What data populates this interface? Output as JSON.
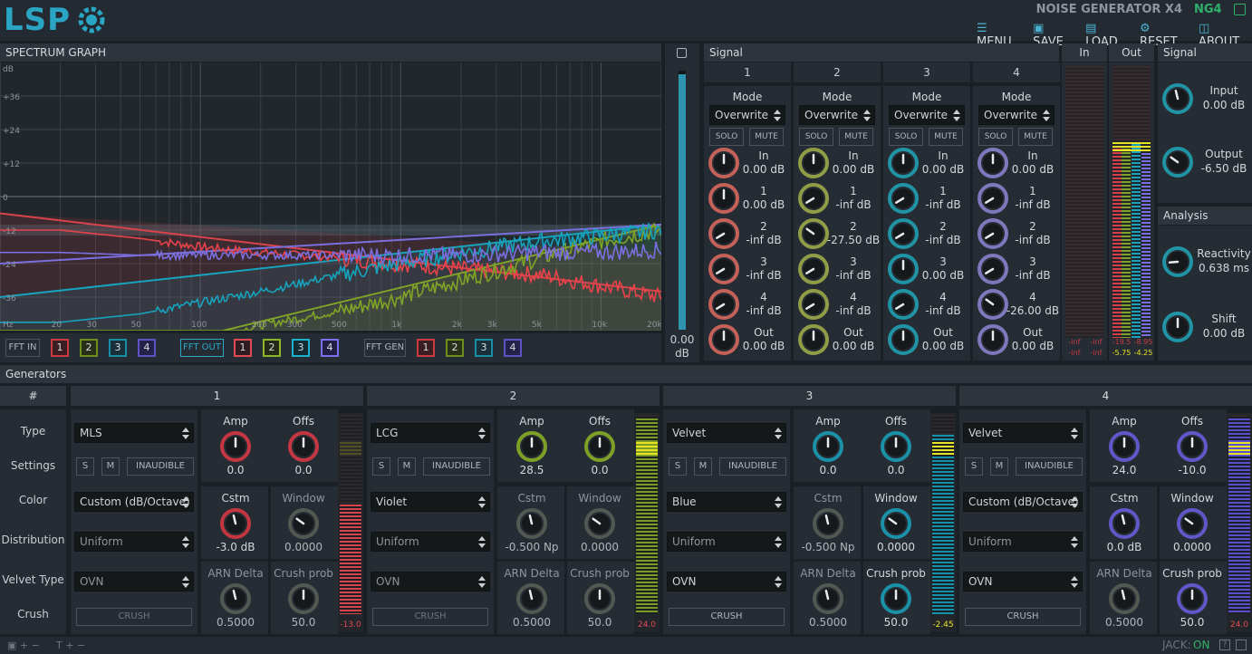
{
  "app": {
    "title": "NOISE GENERATOR X4",
    "code": "NG4",
    "logo": "LSP"
  },
  "menu": [
    {
      "icon": "menu-icon",
      "label": "MENU"
    },
    {
      "icon": "save-icon",
      "label": "SAVE"
    },
    {
      "icon": "load-icon",
      "label": "LOAD"
    },
    {
      "icon": "reset-icon",
      "label": "RESET"
    },
    {
      "icon": "about-icon",
      "label": "ABOUT"
    }
  ],
  "spectrum": {
    "title": "SPECTRUM GRAPH",
    "ylabels": [
      "dB",
      "+36",
      "+24",
      "+12",
      "0",
      "-12",
      "-24",
      "-36"
    ],
    "xlabels": [
      "Hz",
      "20",
      "30",
      "50",
      "100",
      "200",
      "300",
      "500",
      "1k",
      "2k",
      "3k",
      "5k",
      "10k",
      "20k"
    ],
    "buttons": {
      "fft_in": "FFT IN",
      "fft_out": "FFT OUT",
      "fft_gen": "FFT GEN",
      "nums": [
        "1",
        "2",
        "3",
        "4"
      ]
    }
  },
  "chart_data": {
    "type": "line",
    "xlabel": "Hz",
    "ylabel": "dB",
    "ylim": [
      -48,
      48
    ],
    "xscale": "log",
    "xlim": [
      10,
      20000
    ],
    "x": [
      20,
      50,
      100,
      200,
      500,
      1000,
      2000,
      5000,
      10000,
      20000
    ],
    "series": [
      {
        "color": "#e8434b",
        "values": [
          -12,
          -15,
          -18,
          -20,
          -22,
          -24,
          -26,
          -28,
          -32,
          -36
        ]
      },
      {
        "color": "#7fa327",
        "values": [
          -60,
          -58,
          -52,
          -46,
          -41,
          -36,
          -30,
          -22,
          -16,
          -12
        ]
      },
      {
        "color": "#17a3bd",
        "values": [
          -45,
          -42,
          -38,
          -34,
          -28,
          -24,
          -20,
          -16,
          -14,
          -12
        ]
      },
      {
        "color": "#7b6fe0",
        "values": [
          -20,
          -21,
          -21,
          -21,
          -21,
          -21,
          -21,
          -20,
          -20,
          -19
        ]
      }
    ]
  },
  "gain": {
    "value": "0.00",
    "unit": "dB"
  },
  "signal": {
    "title": "Signal",
    "channels": [
      {
        "num": "1",
        "mode": "Overwrite",
        "solo": "SOLO",
        "mute": "MUTE",
        "color": "#e06b60",
        "knobs": [
          [
            "In",
            "0.00 dB"
          ],
          [
            "1",
            "0.00 dB"
          ],
          [
            "2",
            "-inf dB"
          ],
          [
            "3",
            "-inf dB"
          ],
          [
            "4",
            "-inf dB"
          ],
          [
            "Out",
            "0.00 dB"
          ]
        ]
      },
      {
        "num": "2",
        "mode": "Overwrite",
        "solo": "SOLO",
        "mute": "MUTE",
        "color": "#a5b24a",
        "knobs": [
          [
            "In",
            "0.00 dB"
          ],
          [
            "1",
            "-inf dB"
          ],
          [
            "2",
            "-27.50 dB"
          ],
          [
            "3",
            "-inf dB"
          ],
          [
            "4",
            "-inf dB"
          ],
          [
            "Out",
            "0.00 dB"
          ]
        ]
      },
      {
        "num": "3",
        "mode": "Overwrite",
        "solo": "SOLO",
        "mute": "MUTE",
        "color": "#20a6b8",
        "knobs": [
          [
            "In",
            "0.00 dB"
          ],
          [
            "1",
            "-inf dB"
          ],
          [
            "2",
            "-inf dB"
          ],
          [
            "3",
            "0.00 dB"
          ],
          [
            "4",
            "-inf dB"
          ],
          [
            "Out",
            "0.00 dB"
          ]
        ]
      },
      {
        "num": "4",
        "mode": "Overwrite",
        "solo": "SOLO",
        "mute": "MUTE",
        "color": "#8f86d6",
        "knobs": [
          [
            "In",
            "0.00 dB"
          ],
          [
            "1",
            "-inf dB"
          ],
          [
            "2",
            "-inf dB"
          ],
          [
            "3",
            "-inf dB"
          ],
          [
            "4",
            "-26.00 dB"
          ],
          [
            "Out",
            "0.00 dB"
          ]
        ]
      }
    ]
  },
  "meters": {
    "in": "In",
    "out": "Out",
    "in_vals": [
      "-inf",
      "-inf",
      "-inf",
      "-inf"
    ],
    "out_vals": [
      "-19.5",
      "-8.95",
      "-5.75",
      "-4.25"
    ]
  },
  "side": {
    "signal_title": "Signal",
    "input_label": "Input",
    "input_val": "0.00 dB",
    "output_label": "Output",
    "output_val": "-6.50 dB",
    "analysis_title": "Analysis",
    "react_label": "Reactivity",
    "react_val": "0.638 ms",
    "shift_label": "Shift",
    "shift_val": "0.00 dB"
  },
  "generators": {
    "title": "Generators",
    "hash": "#",
    "rows": [
      "Type",
      "Settings",
      "Color",
      "Distribution",
      "Velvet Type",
      "Crush"
    ],
    "gens": [
      {
        "num": "1",
        "type": "MLS",
        "s": "S",
        "m": "M",
        "inaudible": "INAUDIBLE",
        "color": "Custom (dB/Octave)",
        "dist": "Uniform",
        "vtype": "OVN",
        "crush": "CRUSH",
        "kcol": "#e03a45",
        "amp": "0.0",
        "offs": "0.0",
        "cstm": "-3.0 dB",
        "window": "0.0000",
        "arn": "0.5000",
        "cprob": "50.0",
        "meter": "-13.0",
        "mcol": "#d9434b",
        "level": 0.55,
        "amp_l": "Amp",
        "offs_l": "Offs",
        "cstm_l": "Cstm",
        "window_l": "Window",
        "arn_l": "ARN Delta",
        "cprob_l": "Crush prob"
      },
      {
        "num": "2",
        "type": "LCG",
        "s": "S",
        "m": "M",
        "inaudible": "INAUDIBLE",
        "color": "Violet",
        "dist": "Uniform",
        "vtype": "OVN",
        "crush": "CRUSH",
        "kcol": "#8eb526",
        "amp": "28.5",
        "offs": "0.0",
        "cstm": "-0.500 Np",
        "window": "0.0000",
        "arn": "0.5000",
        "cprob": "50.0",
        "meter": "24.0",
        "mcol": "#7c9d23",
        "level": 0.98,
        "amp_l": "Amp",
        "offs_l": "Offs",
        "cstm_l": "Cstm",
        "window_l": "Window",
        "arn_l": "ARN Delta",
        "cprob_l": "Crush prob"
      },
      {
        "num": "3",
        "type": "Velvet",
        "s": "S",
        "m": "M",
        "inaudible": "INAUDIBLE",
        "color": "Blue",
        "dist": "Uniform",
        "vtype": "OVN",
        "crush": "CRUSH",
        "kcol": "#1aa3bc",
        "amp": "0.0",
        "offs": "0.0",
        "cstm": "-0.500 Np",
        "window": "0.0000",
        "arn": "0.5000",
        "cprob": "50.0",
        "meter": "-2.45",
        "mcol": "#1592ab",
        "level": 0.9,
        "amp_l": "Amp",
        "offs_l": "Offs",
        "cstm_l": "Cstm",
        "window_l": "Window",
        "arn_l": "ARN Delta",
        "cprob_l": "Crush prob"
      },
      {
        "num": "4",
        "type": "Velvet",
        "s": "S",
        "m": "M",
        "inaudible": "INAUDIBLE",
        "color": "Custom (dB/Octave)",
        "dist": "Uniform",
        "vtype": "OVN",
        "crush": "CRUSH",
        "kcol": "#6b5fe3",
        "amp": "24.0",
        "offs": "-10.0",
        "cstm": "0.0 dB",
        "window": "0.0000",
        "arn": "0.5000",
        "cprob": "50.0",
        "meter": "24.0",
        "mcol": "#5b4fcf",
        "level": 0.98,
        "amp_l": "Amp",
        "offs_l": "Offs",
        "cstm_l": "Cstm",
        "window_l": "Window",
        "arn_l": "ARN Delta",
        "cprob_l": "Crush prob"
      }
    ]
  },
  "status": {
    "jack_label": "JACK:",
    "jack_val": "ON"
  }
}
